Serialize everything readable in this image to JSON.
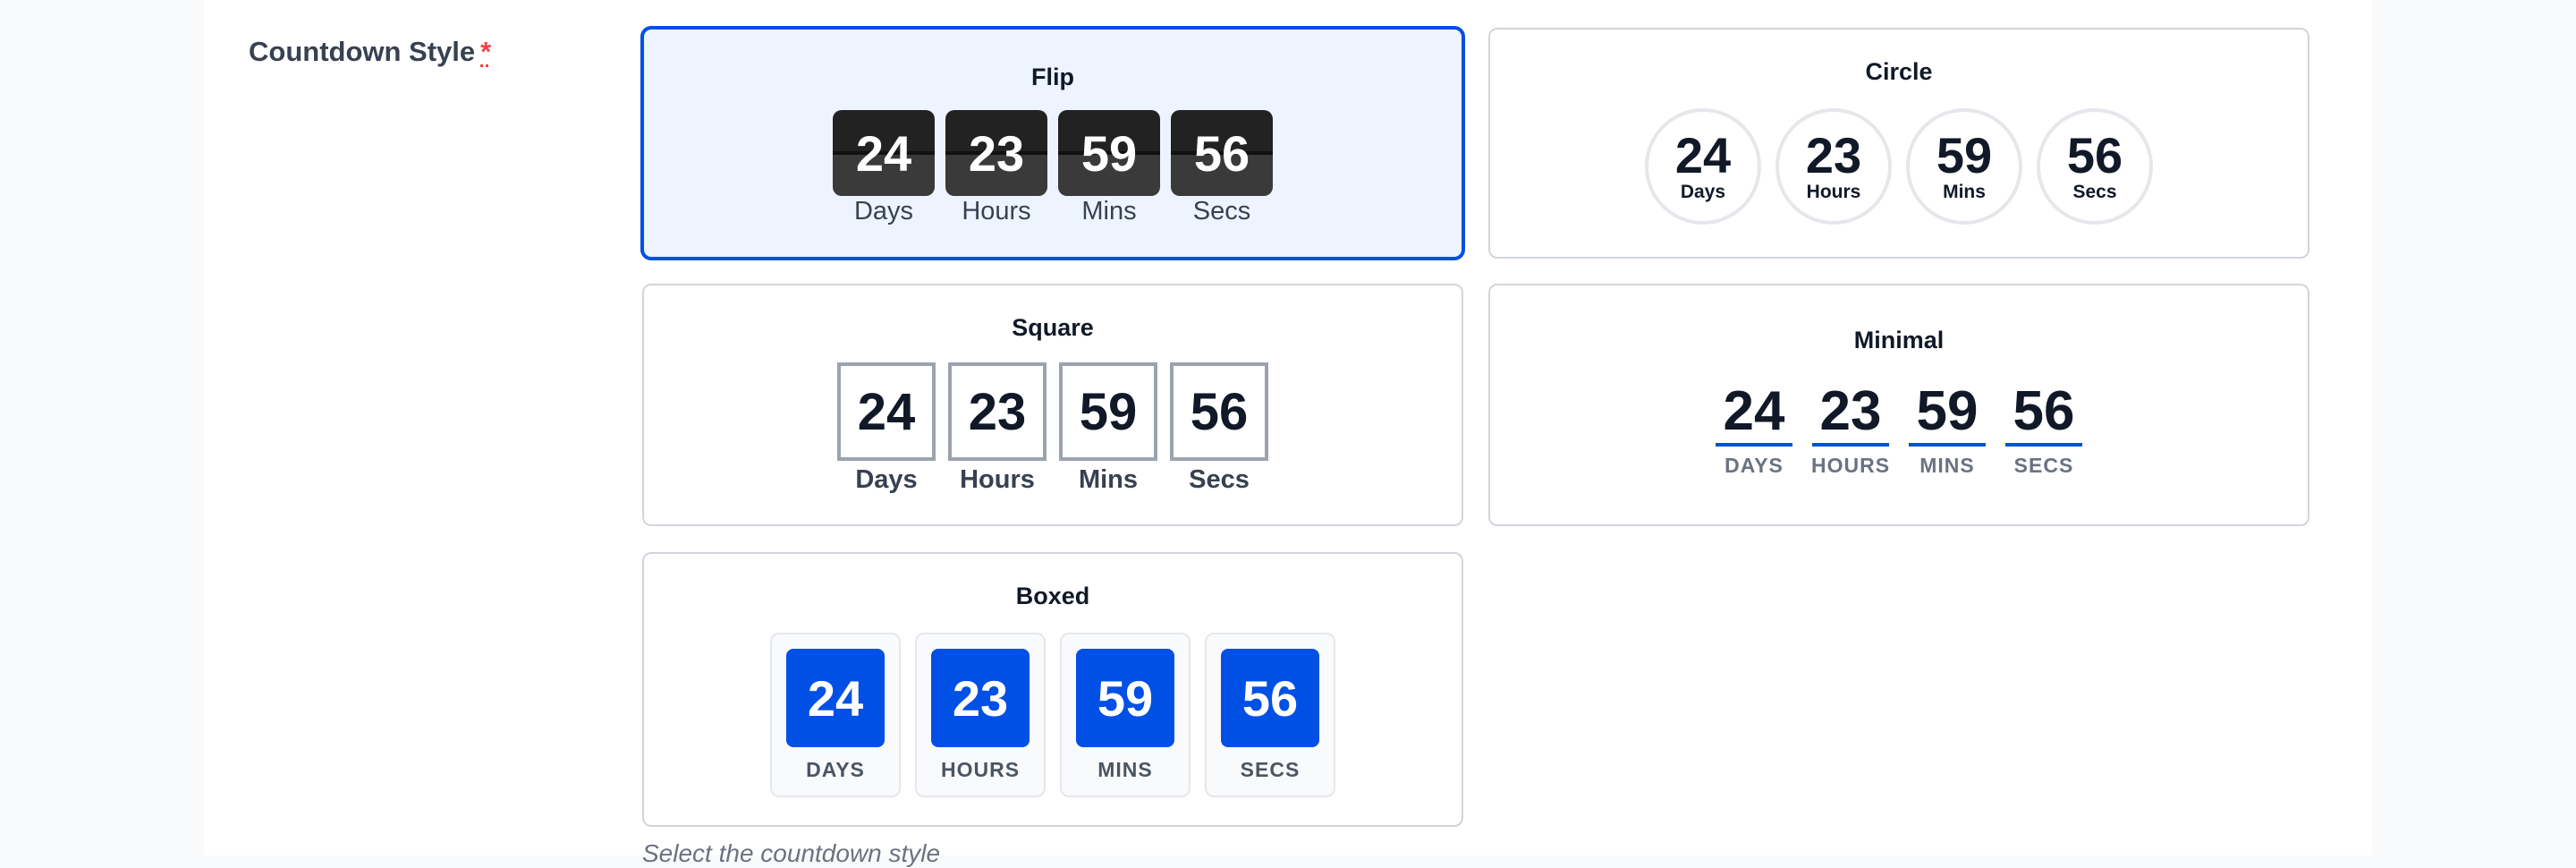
{
  "field": {
    "label": "Countdown Style",
    "required_mark": "*"
  },
  "units": {
    "days": "24",
    "hours": "23",
    "mins": "59",
    "secs": "56"
  },
  "styles": {
    "flip": {
      "title": "Flip",
      "labels": [
        "Days",
        "Hours",
        "Mins",
        "Secs"
      ],
      "selected": true
    },
    "circle": {
      "title": "Circle",
      "labels": [
        "Days",
        "Hours",
        "Mins",
        "Secs"
      ]
    },
    "square": {
      "title": "Square",
      "labels": [
        "Days",
        "Hours",
        "Mins",
        "Secs"
      ]
    },
    "minimal": {
      "title": "Minimal",
      "labels": [
        "DAYS",
        "HOURS",
        "MINS",
        "SECS"
      ]
    },
    "boxed": {
      "title": "Boxed",
      "labels": [
        "DAYS",
        "HOURS",
        "MINS",
        "SECS"
      ]
    }
  },
  "help_text": "Select the countdown style",
  "colors": {
    "accent": "#0050e6",
    "selected_bg": "#eef4ff",
    "required": "#ef4444"
  }
}
